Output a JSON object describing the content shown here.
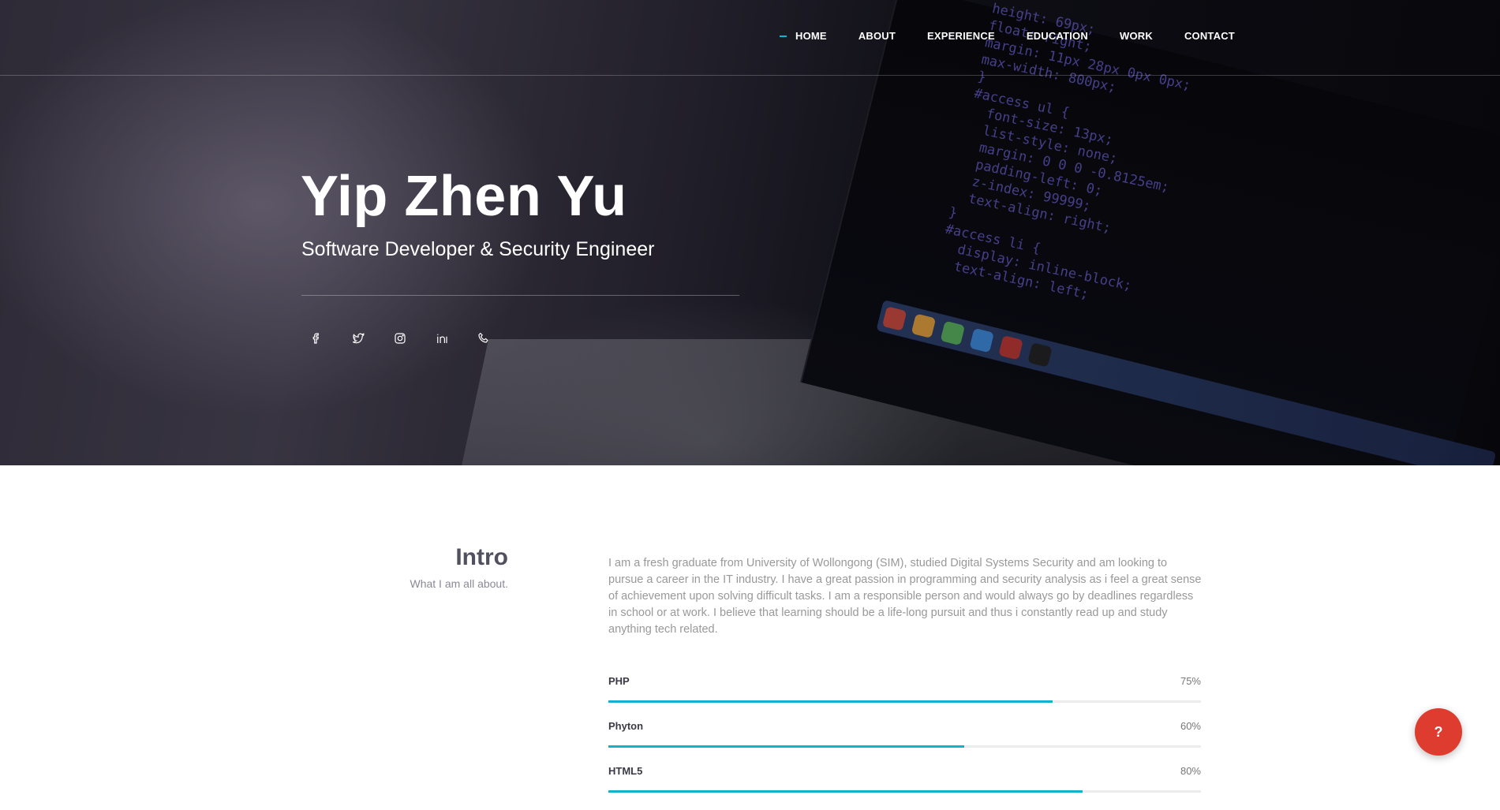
{
  "nav": {
    "items": [
      "HOME",
      "ABOUT",
      "EXPERIENCE",
      "EDUCATION",
      "WORK",
      "CONTACT"
    ],
    "active": "HOME"
  },
  "hero": {
    "name": "Yip Zhen Yu",
    "subtitle": "Software Developer & Security Engineer",
    "social": [
      "facebook-icon",
      "twitter-icon",
      "instagram-icon",
      "linkedin-icon",
      "phone-icon"
    ],
    "background_code": [
      "height: 69px;",
      "float: right;",
      "margin: 11px 28px 0px 0px;",
      "max-width: 800px;",
      "}",
      "#access ul {",
      "  font-size: 13px;",
      "  list-style: none;",
      "  margin: 0 0 0 -0.8125em;",
      "  padding-left: 0;",
      "  z-index: 99999;",
      "  text-align: right;",
      "}",
      "#access li {",
      "  display: inline-block;",
      "  text-align: left;"
    ]
  },
  "intro": {
    "title": "Intro",
    "subtitle": "What I am all about.",
    "text": "I am a fresh graduate from University of Wollongong (SIM), studied Digital Systems Security and am looking to pursue a career in the IT industry. I have a great passion in programming and security analysis as i feel a great sense of achievement upon solving difficult tasks. I am a responsible person and would always go by deadlines regardless in school or at work. I believe that learning should be a life-long pursuit and thus i constantly read up and study anything tech related."
  },
  "skills": [
    {
      "name": "PHP",
      "percent_label": "75%",
      "level": 0.75
    },
    {
      "name": "Phyton",
      "percent_label": "60%",
      "level": 0.6
    },
    {
      "name": "HTML5",
      "percent_label": "80%",
      "level": 0.8
    }
  ],
  "help_button": {
    "label": "?"
  },
  "colors": {
    "accent": "#12b2cd",
    "help": "#dd3c2e",
    "dark_text": "#50505f"
  }
}
